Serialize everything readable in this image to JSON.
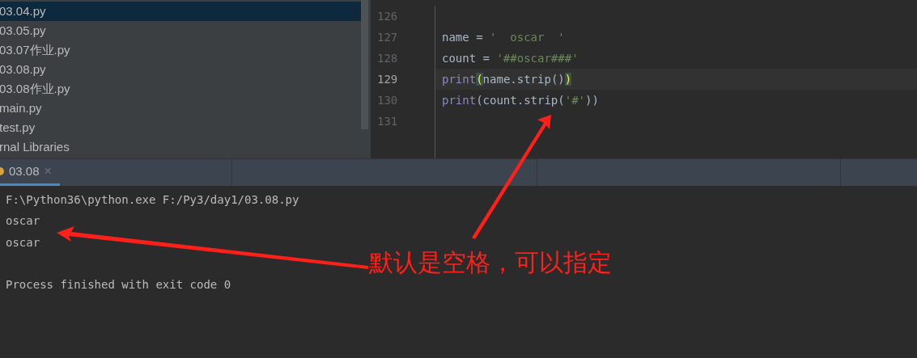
{
  "project_tree": {
    "items": [
      {
        "label": "03.04.py",
        "selected": true
      },
      {
        "label": "03.05.py",
        "selected": false
      },
      {
        "label": "03.07作业.py",
        "selected": false
      },
      {
        "label": "03.08.py",
        "selected": false
      },
      {
        "label": "03.08作业.py",
        "selected": false
      },
      {
        "label": "main.py",
        "selected": false
      },
      {
        "label": "test.py",
        "selected": false
      },
      {
        "label": "rnal Libraries",
        "selected": false
      }
    ]
  },
  "editor": {
    "lines": [
      {
        "number": "126",
        "current": false
      },
      {
        "number": "127",
        "current": false,
        "tokens": [
          {
            "kind": "ident",
            "text": "name = "
          },
          {
            "kind": "string",
            "text": "'  oscar  '"
          }
        ]
      },
      {
        "number": "128",
        "current": false,
        "tokens": [
          {
            "kind": "ident",
            "text": "count = "
          },
          {
            "kind": "string",
            "text": "'##oscar###'"
          }
        ]
      },
      {
        "number": "129",
        "current": true,
        "tokens": [
          {
            "kind": "builtin",
            "text": "print"
          },
          {
            "kind": "match",
            "text": "("
          },
          {
            "kind": "ident",
            "text": "name.strip()"
          },
          {
            "kind": "match",
            "text": ")"
          }
        ]
      },
      {
        "number": "130",
        "current": false,
        "tokens": [
          {
            "kind": "builtin",
            "text": "print"
          },
          {
            "kind": "ident",
            "text": "(count.strip("
          },
          {
            "kind": "string",
            "text": "'#'"
          },
          {
            "kind": "ident",
            "text": "))"
          }
        ]
      },
      {
        "number": "131",
        "current": false
      }
    ]
  },
  "run_tabs": [
    {
      "label": "03.08",
      "close": "×",
      "selected": true
    }
  ],
  "console": {
    "lines": [
      {
        "kind": "output",
        "text": "F:\\Python36\\python.exe F:/Py3/day1/03.08.py"
      },
      {
        "kind": "output",
        "text": "oscar"
      },
      {
        "kind": "output",
        "text": "oscar"
      },
      {
        "kind": "blank"
      },
      {
        "kind": "output",
        "text": "Process finished with exit code 0"
      }
    ]
  },
  "annotation": {
    "text": "默认是空格，可以指定"
  }
}
